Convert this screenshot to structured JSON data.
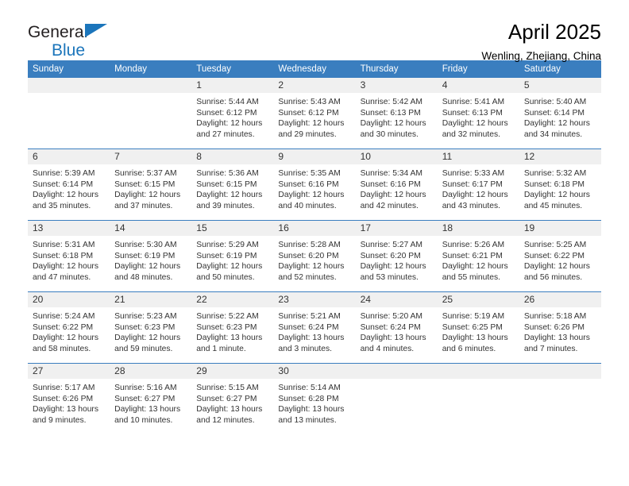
{
  "brand": {
    "name_top": "General",
    "name_bottom": "Blue",
    "triangle_color": "#1b75bb",
    "text_color": "#231f20"
  },
  "header": {
    "title": "April 2025",
    "subtitle": "Wenling, Zhejiang, China"
  },
  "theme": {
    "header_bg": "#3a7ebf",
    "header_text": "#ffffff",
    "daynum_bg": "#f0f0f0",
    "cell_bg": "#ffffff",
    "body_text": "#333333"
  },
  "weekday_headers": [
    "Sunday",
    "Monday",
    "Tuesday",
    "Wednesday",
    "Thursday",
    "Friday",
    "Saturday"
  ],
  "labels": {
    "sunrise": "Sunrise:",
    "sunset": "Sunset:",
    "daylight": "Daylight:"
  },
  "weeks": [
    [
      {
        "day": "",
        "blank": true,
        "sunrise": "",
        "sunset": "",
        "daylight": ""
      },
      {
        "day": "",
        "blank": true,
        "sunrise": "",
        "sunset": "",
        "daylight": ""
      },
      {
        "day": "1",
        "blank": false,
        "sunrise": "Sunrise: 5:44 AM",
        "sunset": "Sunset: 6:12 PM",
        "daylight": "Daylight: 12 hours and 27 minutes."
      },
      {
        "day": "2",
        "blank": false,
        "sunrise": "Sunrise: 5:43 AM",
        "sunset": "Sunset: 6:12 PM",
        "daylight": "Daylight: 12 hours and 29 minutes."
      },
      {
        "day": "3",
        "blank": false,
        "sunrise": "Sunrise: 5:42 AM",
        "sunset": "Sunset: 6:13 PM",
        "daylight": "Daylight: 12 hours and 30 minutes."
      },
      {
        "day": "4",
        "blank": false,
        "sunrise": "Sunrise: 5:41 AM",
        "sunset": "Sunset: 6:13 PM",
        "daylight": "Daylight: 12 hours and 32 minutes."
      },
      {
        "day": "5",
        "blank": false,
        "sunrise": "Sunrise: 5:40 AM",
        "sunset": "Sunset: 6:14 PM",
        "daylight": "Daylight: 12 hours and 34 minutes."
      }
    ],
    [
      {
        "day": "6",
        "blank": false,
        "sunrise": "Sunrise: 5:39 AM",
        "sunset": "Sunset: 6:14 PM",
        "daylight": "Daylight: 12 hours and 35 minutes."
      },
      {
        "day": "7",
        "blank": false,
        "sunrise": "Sunrise: 5:37 AM",
        "sunset": "Sunset: 6:15 PM",
        "daylight": "Daylight: 12 hours and 37 minutes."
      },
      {
        "day": "8",
        "blank": false,
        "sunrise": "Sunrise: 5:36 AM",
        "sunset": "Sunset: 6:15 PM",
        "daylight": "Daylight: 12 hours and 39 minutes."
      },
      {
        "day": "9",
        "blank": false,
        "sunrise": "Sunrise: 5:35 AM",
        "sunset": "Sunset: 6:16 PM",
        "daylight": "Daylight: 12 hours and 40 minutes."
      },
      {
        "day": "10",
        "blank": false,
        "sunrise": "Sunrise: 5:34 AM",
        "sunset": "Sunset: 6:16 PM",
        "daylight": "Daylight: 12 hours and 42 minutes."
      },
      {
        "day": "11",
        "blank": false,
        "sunrise": "Sunrise: 5:33 AM",
        "sunset": "Sunset: 6:17 PM",
        "daylight": "Daylight: 12 hours and 43 minutes."
      },
      {
        "day": "12",
        "blank": false,
        "sunrise": "Sunrise: 5:32 AM",
        "sunset": "Sunset: 6:18 PM",
        "daylight": "Daylight: 12 hours and 45 minutes."
      }
    ],
    [
      {
        "day": "13",
        "blank": false,
        "sunrise": "Sunrise: 5:31 AM",
        "sunset": "Sunset: 6:18 PM",
        "daylight": "Daylight: 12 hours and 47 minutes."
      },
      {
        "day": "14",
        "blank": false,
        "sunrise": "Sunrise: 5:30 AM",
        "sunset": "Sunset: 6:19 PM",
        "daylight": "Daylight: 12 hours and 48 minutes."
      },
      {
        "day": "15",
        "blank": false,
        "sunrise": "Sunrise: 5:29 AM",
        "sunset": "Sunset: 6:19 PM",
        "daylight": "Daylight: 12 hours and 50 minutes."
      },
      {
        "day": "16",
        "blank": false,
        "sunrise": "Sunrise: 5:28 AM",
        "sunset": "Sunset: 6:20 PM",
        "daylight": "Daylight: 12 hours and 52 minutes."
      },
      {
        "day": "17",
        "blank": false,
        "sunrise": "Sunrise: 5:27 AM",
        "sunset": "Sunset: 6:20 PM",
        "daylight": "Daylight: 12 hours and 53 minutes."
      },
      {
        "day": "18",
        "blank": false,
        "sunrise": "Sunrise: 5:26 AM",
        "sunset": "Sunset: 6:21 PM",
        "daylight": "Daylight: 12 hours and 55 minutes."
      },
      {
        "day": "19",
        "blank": false,
        "sunrise": "Sunrise: 5:25 AM",
        "sunset": "Sunset: 6:22 PM",
        "daylight": "Daylight: 12 hours and 56 minutes."
      }
    ],
    [
      {
        "day": "20",
        "blank": false,
        "sunrise": "Sunrise: 5:24 AM",
        "sunset": "Sunset: 6:22 PM",
        "daylight": "Daylight: 12 hours and 58 minutes."
      },
      {
        "day": "21",
        "blank": false,
        "sunrise": "Sunrise: 5:23 AM",
        "sunset": "Sunset: 6:23 PM",
        "daylight": "Daylight: 12 hours and 59 minutes."
      },
      {
        "day": "22",
        "blank": false,
        "sunrise": "Sunrise: 5:22 AM",
        "sunset": "Sunset: 6:23 PM",
        "daylight": "Daylight: 13 hours and 1 minute."
      },
      {
        "day": "23",
        "blank": false,
        "sunrise": "Sunrise: 5:21 AM",
        "sunset": "Sunset: 6:24 PM",
        "daylight": "Daylight: 13 hours and 3 minutes."
      },
      {
        "day": "24",
        "blank": false,
        "sunrise": "Sunrise: 5:20 AM",
        "sunset": "Sunset: 6:24 PM",
        "daylight": "Daylight: 13 hours and 4 minutes."
      },
      {
        "day": "25",
        "blank": false,
        "sunrise": "Sunrise: 5:19 AM",
        "sunset": "Sunset: 6:25 PM",
        "daylight": "Daylight: 13 hours and 6 minutes."
      },
      {
        "day": "26",
        "blank": false,
        "sunrise": "Sunrise: 5:18 AM",
        "sunset": "Sunset: 6:26 PM",
        "daylight": "Daylight: 13 hours and 7 minutes."
      }
    ],
    [
      {
        "day": "27",
        "blank": false,
        "sunrise": "Sunrise: 5:17 AM",
        "sunset": "Sunset: 6:26 PM",
        "daylight": "Daylight: 13 hours and 9 minutes."
      },
      {
        "day": "28",
        "blank": false,
        "sunrise": "Sunrise: 5:16 AM",
        "sunset": "Sunset: 6:27 PM",
        "daylight": "Daylight: 13 hours and 10 minutes."
      },
      {
        "day": "29",
        "blank": false,
        "sunrise": "Sunrise: 5:15 AM",
        "sunset": "Sunset: 6:27 PM",
        "daylight": "Daylight: 13 hours and 12 minutes."
      },
      {
        "day": "30",
        "blank": false,
        "sunrise": "Sunrise: 5:14 AM",
        "sunset": "Sunset: 6:28 PM",
        "daylight": "Daylight: 13 hours and 13 minutes."
      },
      {
        "day": "",
        "blank": true,
        "sunrise": "",
        "sunset": "",
        "daylight": ""
      },
      {
        "day": "",
        "blank": true,
        "sunrise": "",
        "sunset": "",
        "daylight": ""
      },
      {
        "day": "",
        "blank": true,
        "sunrise": "",
        "sunset": "",
        "daylight": ""
      }
    ]
  ]
}
